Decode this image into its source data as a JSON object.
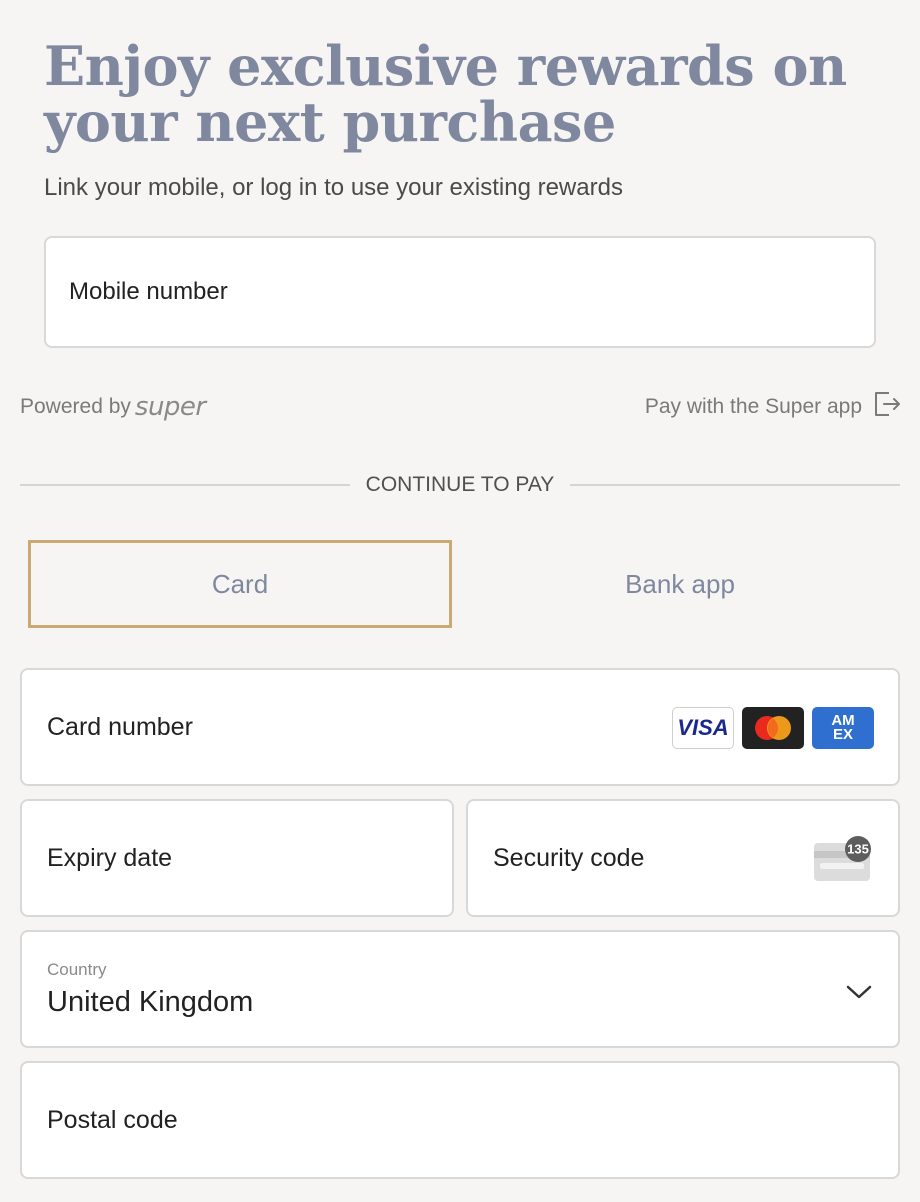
{
  "header": {
    "title": "Enjoy exclusive rewards on your next purchase",
    "subtitle": "Link your mobile, or log in to use your existing rewards"
  },
  "rewards": {
    "mobile_label": "Mobile number",
    "powered_by": "Powered by",
    "powered_brand": "super",
    "pay_with_app": "Pay with the Super app"
  },
  "divider": {
    "label": "CONTINUE TO PAY"
  },
  "tabs": [
    {
      "label": "Card",
      "selected": true
    },
    {
      "label": "Bank app",
      "selected": false
    }
  ],
  "card_form": {
    "card_number_label": "Card number",
    "brands": {
      "visa": "VISA",
      "amex_line1": "AM",
      "amex_line2": "EX"
    },
    "expiry_label": "Expiry date",
    "security_label": "Security code",
    "security_hint": "135",
    "country_label": "Country",
    "country_value": "United Kingdom",
    "postal_label": "Postal code"
  },
  "colors": {
    "accent_title": "#7f889f",
    "selected_tab_border": "#c8aa72",
    "background": "#f6f5f3"
  }
}
